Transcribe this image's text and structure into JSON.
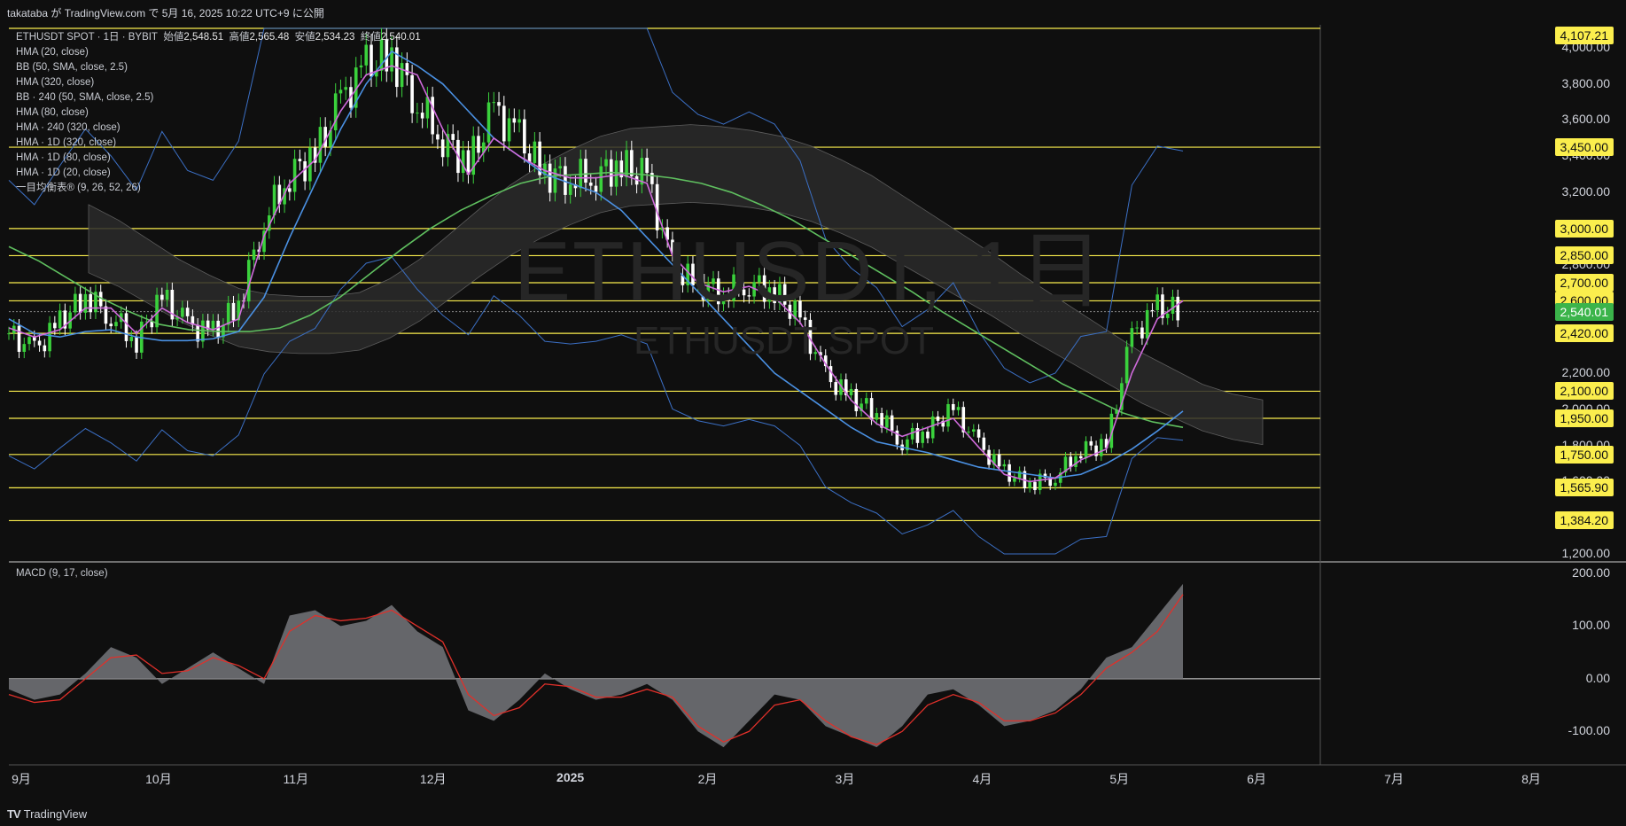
{
  "header": {
    "publish_text": "takataba が TradingView.com で 5月 16, 2025 10:22 UTC+9 に公開"
  },
  "legend": {
    "symbol_line": "ETHUSDT SPOT · 1日 · BYBIT",
    "open_label": "始値",
    "open": "2,548.51",
    "high_label": "高値",
    "high": "2,565.48",
    "low_label": "安値",
    "low": "2,534.23",
    "close_label": "終値",
    "close": "2,540.01",
    "indicators": [
      "HMA (20, close)",
      "BB (50, SMA, close, 2.5)",
      "HMA (320, close)",
      "BB · 240 (50, SMA, close, 2.5)",
      "HMA (80, close)",
      "HMA · 240 (320, close)",
      "HMA · 1D (320, close)",
      "HMA · 1D (80, close)",
      "HMA · 1D (20, close)",
      "一目均衡表® (9, 26, 52, 26)"
    ]
  },
  "watermark": {
    "title": "ETHUSDT, 1日",
    "subtitle": "ETHUSDT SPOT"
  },
  "macd": {
    "title": "MACD (9, 17, close)"
  },
  "price_axis": {
    "labels": [
      "4,000.00",
      "3,800.00",
      "3,600.00",
      "3,400.00",
      "3,200.00",
      "3,000.00",
      "2,800.00",
      "2,600.00",
      "2,400.00",
      "2,200.00",
      "2,000.00",
      "1,800.00",
      "1,600.00",
      "1,400.00",
      "1,200.00"
    ],
    "horizontal_levels": [
      "4,107.21",
      "3,450.00",
      "3,000.00",
      "2,850.00",
      "2,700.00",
      "2,600.00",
      "2,420.00",
      "2,100.00",
      "1,950.00",
      "1,750.00",
      "1,565.90",
      "1,384.20"
    ],
    "current_price": "2,540.01"
  },
  "macd_axis": {
    "labels": [
      "200.00",
      "100.00",
      "0.00",
      "-100.00"
    ]
  },
  "time_axis": {
    "labels": [
      "9月",
      "10月",
      "11月",
      "12月",
      "2025",
      "2月",
      "3月",
      "4月",
      "5月",
      "6月",
      "7月",
      "8月"
    ],
    "year_label": "2025"
  },
  "footer": {
    "brand": "TradingView",
    "logo_mark": "TV"
  },
  "colors": {
    "background": "#0f0f0f",
    "level_line": "#fbee4d",
    "candle_up": "#3ad13c",
    "candle_down": "#ffffff",
    "hma20": "#d06bdc",
    "hma80": "#4a90e2",
    "hma320": "#5fbf5f",
    "bollinger": "#3b6fc4",
    "cloud": "#2b2b2b",
    "macd_hist": "#6a6b70",
    "macd_signal": "#e0302a"
  },
  "chart_data": {
    "type": "candlestick",
    "symbol": "ETHUSDT",
    "timeframe": "1日",
    "ylim": [
      1200,
      4107.21
    ],
    "horizontal_levels": [
      4107.21,
      3450,
      3000,
      2850,
      2700,
      2600,
      2420,
      2100,
      1950,
      1750,
      1565.9,
      1384.2
    ],
    "current_price": 2540.01,
    "months": [
      "9月",
      "10月",
      "11月",
      "12月",
      "2025",
      "2月",
      "3月",
      "4月",
      "5月",
      "6月",
      "7月",
      "8月"
    ],
    "close_series_weekly": [
      2420,
      2320,
      2480,
      2630,
      2520,
      2380,
      2620,
      2460,
      2420,
      2580,
      3050,
      3300,
      3400,
      3700,
      3900,
      3950,
      3700,
      3500,
      3350,
      3650,
      3500,
      3300,
      3280,
      3300,
      3350,
      3280,
      2780,
      2690,
      2650,
      2700,
      2650,
      2500,
      2180,
      2060,
      1980,
      1820,
      1890,
      2000,
      1800,
      1650,
      1590,
      1630,
      1780,
      1800,
      2400,
      2560,
      2540
    ],
    "hma20_weekly": [
      2450,
      2400,
      2440,
      2560,
      2560,
      2420,
      2560,
      2480,
      2440,
      2500,
      2960,
      3250,
      3380,
      3650,
      3850,
      3900,
      3850,
      3550,
      3300,
      3500,
      3400,
      3320,
      3280,
      3280,
      3300,
      3250,
      2850,
      2700,
      2650,
      2680,
      2620,
      2480,
      2250,
      2050,
      1920,
      1850,
      1900,
      1950,
      1790,
      1640,
      1600,
      1620,
      1720,
      1780,
      2200,
      2500,
      2600
    ],
    "hma80_weekly": [
      2500,
      2420,
      2400,
      2430,
      2440,
      2400,
      2380,
      2380,
      2390,
      2430,
      2620,
      2950,
      3250,
      3550,
      3800,
      3980,
      3900,
      3800,
      3650,
      3500,
      3400,
      3300,
      3250,
      3200,
      3100,
      2950,
      2800,
      2650,
      2500,
      2350,
      2200,
      2100,
      2000,
      1900,
      1820,
      1790,
      1760,
      1720,
      1680,
      1660,
      1640,
      1620,
      1640,
      1700,
      1780,
      1880,
      1990
    ],
    "hma320_weekly": [
      2900,
      2820,
      2720,
      2620,
      2540,
      2470,
      2440,
      2430,
      2430,
      2450,
      2520,
      2620,
      2750,
      2880,
      3000,
      3100,
      3180,
      3250,
      3290,
      3300,
      3310,
      3300,
      3280,
      3250,
      3200,
      3130,
      3050,
      2950,
      2850,
      2750,
      2650,
      2540,
      2440,
      2340,
      2240,
      2140,
      2060,
      1980,
      1930,
      1900
    ],
    "macd_hist_weekly": [
      -20,
      -40,
      -30,
      10,
      60,
      40,
      -10,
      20,
      50,
      20,
      -10,
      120,
      130,
      100,
      110,
      140,
      90,
      60,
      -60,
      -80,
      -40,
      10,
      -20,
      -40,
      -30,
      -10,
      -40,
      -100,
      -130,
      -80,
      -30,
      -40,
      -90,
      -110,
      -130,
      -90,
      -30,
      -20,
      -50,
      -90,
      -80,
      -60,
      -20,
      40,
      60,
      120,
      180
    ],
    "macd_signal_weekly": [
      -30,
      -45,
      -40,
      0,
      40,
      45,
      10,
      15,
      40,
      25,
      0,
      90,
      120,
      110,
      115,
      130,
      100,
      70,
      -30,
      -70,
      -55,
      -10,
      -15,
      -35,
      -35,
      -20,
      -35,
      -90,
      -120,
      -100,
      -50,
      -40,
      -80,
      -110,
      -125,
      -100,
      -50,
      -30,
      -45,
      -80,
      -80,
      -65,
      -30,
      20,
      50,
      90,
      160
    ],
    "macd_ylim": [
      -150,
      210
    ]
  }
}
